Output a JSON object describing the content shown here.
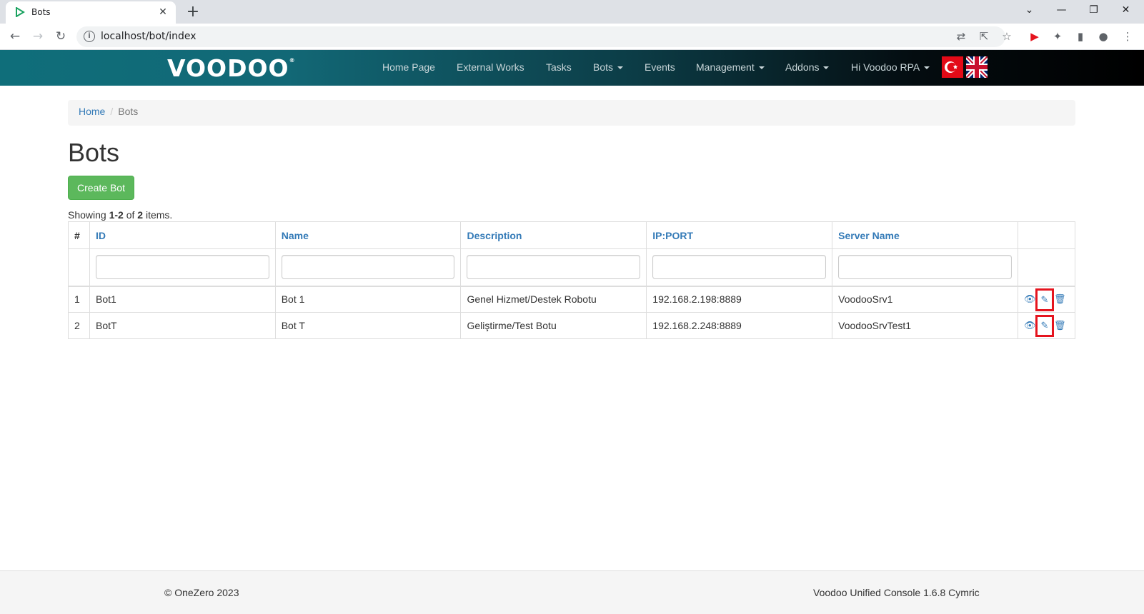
{
  "browser": {
    "tab_title": "Bots",
    "new_tab": "+",
    "url": "localhost/bot/index"
  },
  "navbar": {
    "logo": "VOOD",
    "logo_end": "OO",
    "links": [
      {
        "label": "Home Page"
      },
      {
        "label": "External Works"
      },
      {
        "label": "Tasks"
      },
      {
        "label": "Bots"
      },
      {
        "label": "Events"
      },
      {
        "label": "Management"
      },
      {
        "label": "Addons"
      },
      {
        "label": "Hi Voodoo RPA"
      }
    ]
  },
  "breadcrumb": {
    "home": "Home",
    "current": "Bots"
  },
  "page": {
    "title": "Bots",
    "create_button": "Create Bot",
    "summary_prefix": "Showing ",
    "summary_range": "1-2",
    "summary_mid": " of ",
    "summary_total": "2",
    "summary_suffix": " items."
  },
  "table": {
    "headers": [
      "#",
      "ID",
      "Name",
      "Description",
      "IP:PORT",
      "Server Name"
    ],
    "rows": [
      {
        "num": "1",
        "id": "Bot1",
        "name": "Bot 1",
        "description": "Genel Hizmet/Destek Robotu",
        "ip_port": "192.168.2.198:8889",
        "server": "VoodooSrv1"
      },
      {
        "num": "2",
        "id": "BotT",
        "name": "Bot T",
        "description": "Geliştirme/Test Botu",
        "ip_port": "192.168.2.248:8889",
        "server": "VoodooSrvTest1"
      }
    ]
  },
  "footer": {
    "copyright": "© OneZero 2023",
    "version": "Voodoo Unified Console 1.6.8 Cymric"
  },
  "colors": {
    "accent": "#337ab7",
    "success": "#5cb85c",
    "highlight": "#e5141e"
  }
}
